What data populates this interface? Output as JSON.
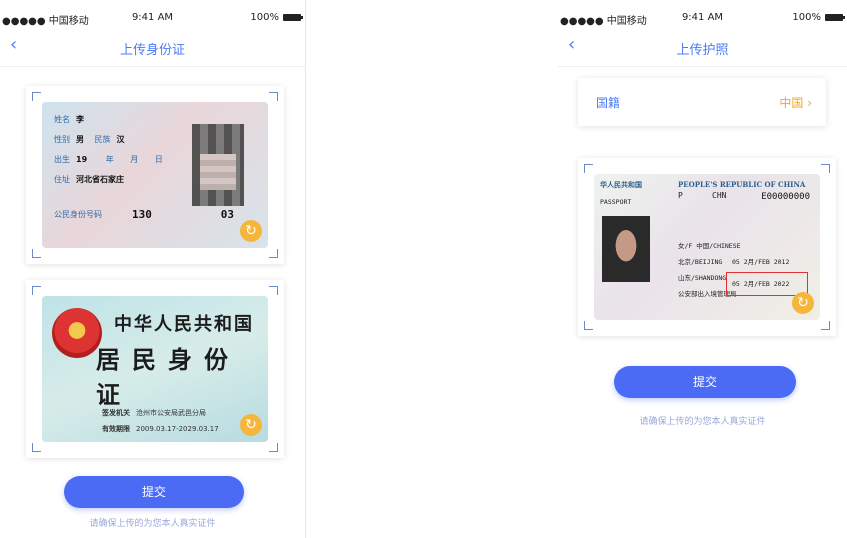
{
  "left_screen": {
    "status": {
      "carrier": "●●●●● 中国移动",
      "time": "9:41 AM",
      "battery": "100%"
    },
    "nav": {
      "back": "‹",
      "title": "上传身份证"
    },
    "front_card": {
      "name_label": "姓名",
      "name_value": "李",
      "sex_label": "性别",
      "sex_value": "男",
      "ethnic_label": "民族",
      "ethnic_value": "汉",
      "birth_label": "出生",
      "birth_year": "19",
      "birth_month_label": "年",
      "birth_day_label": "月",
      "birth_d": "日",
      "addr_label": "住址",
      "addr_value": "河北省石家庄",
      "idnum_label": "公民身份号码",
      "idnum_start": "130",
      "idnum_end": "03"
    },
    "back_card": {
      "title_1": "中华人民共和国",
      "title_2": "居民身份证",
      "authority_label": "签发机关",
      "authority_value": "沧州市公安局武邑分局",
      "validity_label": "有效期限",
      "validity_value": "2009.03.17-2029.03.17"
    },
    "submit_label": "提交",
    "hint": "请确保上传的为您本人真实证件"
  },
  "right_screen": {
    "status": {
      "carrier": "●●●●● 中国移动",
      "time": "9:41 AM",
      "battery": "100%"
    },
    "nav": {
      "back": "‹",
      "title": "上传护照"
    },
    "nationality": {
      "label": "国籍",
      "value": "中国 ›"
    },
    "passport": {
      "header_cn": "华人民共和国",
      "header_en": "PEOPLE'S REPUBLIC OF CHINA",
      "type_label": "PASSPORT",
      "type_value": "P",
      "country_code": "CHN",
      "passport_no": "E00000000",
      "sex_nationality": "女/F   中国/CHINESE",
      "birth_place": "北京/BEIJING",
      "issue_place": "山东/SHANDONG",
      "issue_date": "05 2月/FEB 2012",
      "expiry_date": "05 2月/FEB 2022",
      "authority": "公安部出入境管理局"
    },
    "submit_label": "提交",
    "hint": "请确保上传的为您本人真实证件"
  },
  "colors": {
    "accent": "#4b6bf5",
    "orange": "#f5a623",
    "link": "#4a7bf7"
  },
  "icons": {
    "back": "chevron-left-icon",
    "rotate": "rotate-icon",
    "chevron": "chevron-right-icon"
  }
}
